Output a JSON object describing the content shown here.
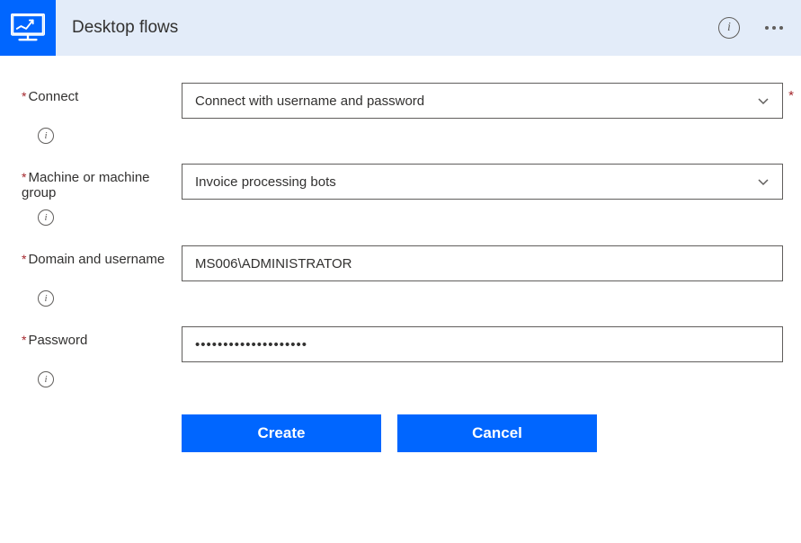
{
  "header": {
    "title": "Desktop flows"
  },
  "form": {
    "connect": {
      "label": "Connect",
      "value": "Connect with username and password"
    },
    "machine": {
      "label": "Machine or machine group",
      "value": "Invoice processing bots"
    },
    "domain": {
      "label": "Domain and username",
      "value": "MS006\\ADMINISTRATOR"
    },
    "password": {
      "label": "Password",
      "value": "••••••••••••••••••••"
    }
  },
  "buttons": {
    "create": "Create",
    "cancel": "Cancel"
  }
}
